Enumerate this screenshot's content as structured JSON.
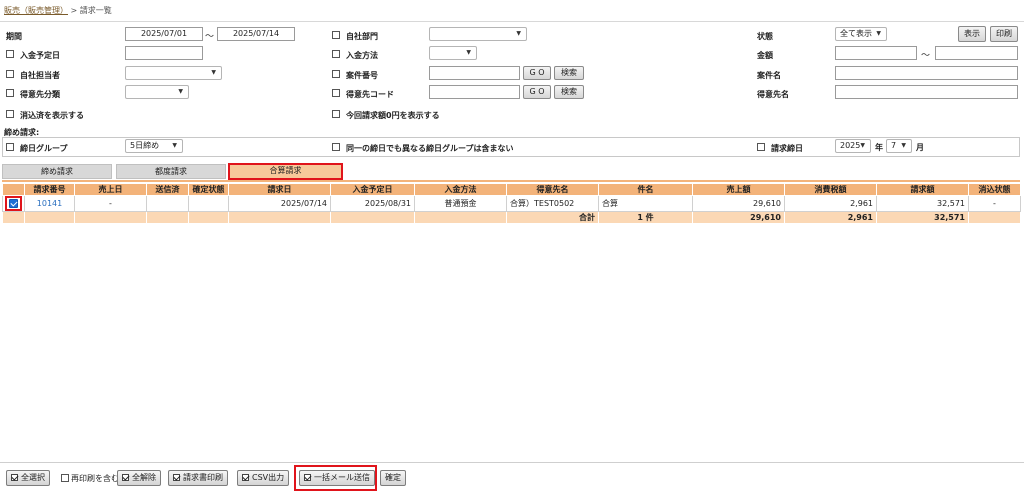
{
  "breadcrumb": {
    "parent": "販売（販売管理）",
    "sep": ">",
    "current": "請求一覧"
  },
  "filters": {
    "period_label": "期間",
    "period_from": "2025/07/01",
    "period_tilde": "〜",
    "period_to": "2025/07/14",
    "payment_due_label": "入金予定日",
    "staff_label": "自社担当者",
    "customer_class_label": "得意先分類",
    "show_cleared_label": "消込済を表示する",
    "dept_label": "自社部門",
    "payment_method_label": "入金方法",
    "project_no_label": "案件番号",
    "customer_code_label": "得意先コード",
    "show_zero_label": "今回請求額0円を表示する",
    "go_label": "G O",
    "search_label": "検索",
    "status_label": "状態",
    "status_value": "全て表示",
    "show_button": "表示",
    "print_button": "印刷",
    "amount_label": "金額",
    "amount_tilde": "〜",
    "project_name_label": "案件名",
    "customer_name_label": "得意先名",
    "closing_section_label": "締め請求:",
    "closing_group_label": "締日グループ",
    "closing_group_value": "5日締め",
    "same_day_label": "同一の締日でも異なる締日グループは含まない",
    "billing_close_label": "請求締日",
    "year_value": "2025",
    "year_unit": "年",
    "month_value": "7",
    "month_unit": "月"
  },
  "tabs": [
    {
      "label": "締め請求"
    },
    {
      "label": "都度請求"
    },
    {
      "label": "合算請求"
    }
  ],
  "table": {
    "headers": [
      "請求番号",
      "売上日",
      "送信済",
      "確定状態",
      "請求日",
      "入金予定日",
      "入金方法",
      "得意先名",
      "件名",
      "売上額",
      "消費税額",
      "請求額",
      "消込状態"
    ],
    "rows": [
      {
        "no": "10141",
        "sales_date": "-",
        "sent": "",
        "confirmed": "",
        "bill_date": "2025/07/14",
        "due_date": "2025/08/31",
        "method": "普通預金",
        "customer": "合算）TEST0502",
        "subject": "合算",
        "sales": "29,610",
        "tax": "2,961",
        "bill": "32,571",
        "clear": "-"
      }
    ],
    "total": {
      "label": "合計",
      "count": "1 件",
      "sales": "29,610",
      "tax": "2,961",
      "bill": "32,571"
    }
  },
  "footer": {
    "select_all": "全選択",
    "reprint": "再印刷を含む",
    "deselect_all": "全解除",
    "print_invoice": "請求書印刷",
    "csv": "CSV出力",
    "bulk_mail": "一括メール送信",
    "confirm": "確定"
  }
}
